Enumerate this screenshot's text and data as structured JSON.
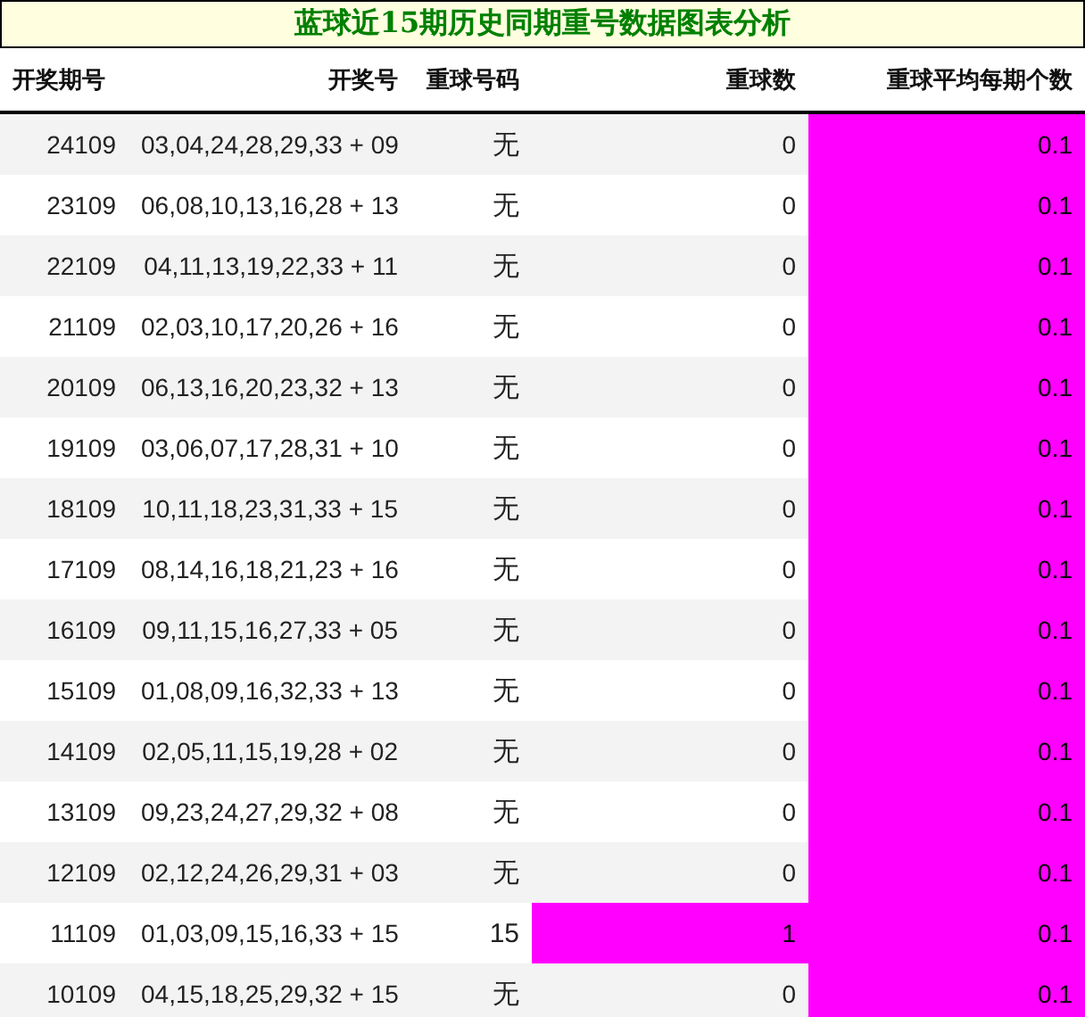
{
  "title": "蓝球近15期历史同期重号数据图表分析",
  "columns": [
    "开奖期号",
    "开奖号",
    "重球号码",
    "重球数",
    "重球平均每期个数"
  ],
  "rows": [
    {
      "period": "24109",
      "numbers": "03,04,24,28,29,33 + 09",
      "repeat": "无",
      "count": "0",
      "count_highlighted": false,
      "average": "0.1",
      "average_highlighted": true
    },
    {
      "period": "23109",
      "numbers": "06,08,10,13,16,28 + 13",
      "repeat": "无",
      "count": "0",
      "count_highlighted": false,
      "average": "0.1",
      "average_highlighted": true
    },
    {
      "period": "22109",
      "numbers": "04,11,13,19,22,33 + 11",
      "repeat": "无",
      "count": "0",
      "count_highlighted": false,
      "average": "0.1",
      "average_highlighted": true
    },
    {
      "period": "21109",
      "numbers": "02,03,10,17,20,26 + 16",
      "repeat": "无",
      "count": "0",
      "count_highlighted": false,
      "average": "0.1",
      "average_highlighted": true
    },
    {
      "period": "20109",
      "numbers": "06,13,16,20,23,32 + 13",
      "repeat": "无",
      "count": "0",
      "count_highlighted": false,
      "average": "0.1",
      "average_highlighted": true
    },
    {
      "period": "19109",
      "numbers": "03,06,07,17,28,31 + 10",
      "repeat": "无",
      "count": "0",
      "count_highlighted": false,
      "average": "0.1",
      "average_highlighted": true
    },
    {
      "period": "18109",
      "numbers": "10,11,18,23,31,33 + 15",
      "repeat": "无",
      "count": "0",
      "count_highlighted": false,
      "average": "0.1",
      "average_highlighted": true
    },
    {
      "period": "17109",
      "numbers": "08,14,16,18,21,23 + 16",
      "repeat": "无",
      "count": "0",
      "count_highlighted": false,
      "average": "0.1",
      "average_highlighted": true
    },
    {
      "period": "16109",
      "numbers": "09,11,15,16,27,33 + 05",
      "repeat": "无",
      "count": "0",
      "count_highlighted": false,
      "average": "0.1",
      "average_highlighted": true
    },
    {
      "period": "15109",
      "numbers": "01,08,09,16,32,33 + 13",
      "repeat": "无",
      "count": "0",
      "count_highlighted": false,
      "average": "0.1",
      "average_highlighted": true
    },
    {
      "period": "14109",
      "numbers": "02,05,11,15,19,28 + 02",
      "repeat": "无",
      "count": "0",
      "count_highlighted": false,
      "average": "0.1",
      "average_highlighted": true
    },
    {
      "period": "13109",
      "numbers": "09,23,24,27,29,32 + 08",
      "repeat": "无",
      "count": "0",
      "count_highlighted": false,
      "average": "0.1",
      "average_highlighted": true
    },
    {
      "period": "12109",
      "numbers": "02,12,24,26,29,31 + 03",
      "repeat": "无",
      "count": "0",
      "count_highlighted": false,
      "average": "0.1",
      "average_highlighted": true
    },
    {
      "period": "11109",
      "numbers": "01,03,09,15,16,33 + 15",
      "repeat": "15",
      "count": "1",
      "count_highlighted": true,
      "average": "0.1",
      "average_highlighted": true
    },
    {
      "period": "10109",
      "numbers": "04,15,18,25,29,32 + 15",
      "repeat": "无",
      "count": "0",
      "count_highlighted": false,
      "average": "0.1",
      "average_highlighted": true
    }
  ]
}
